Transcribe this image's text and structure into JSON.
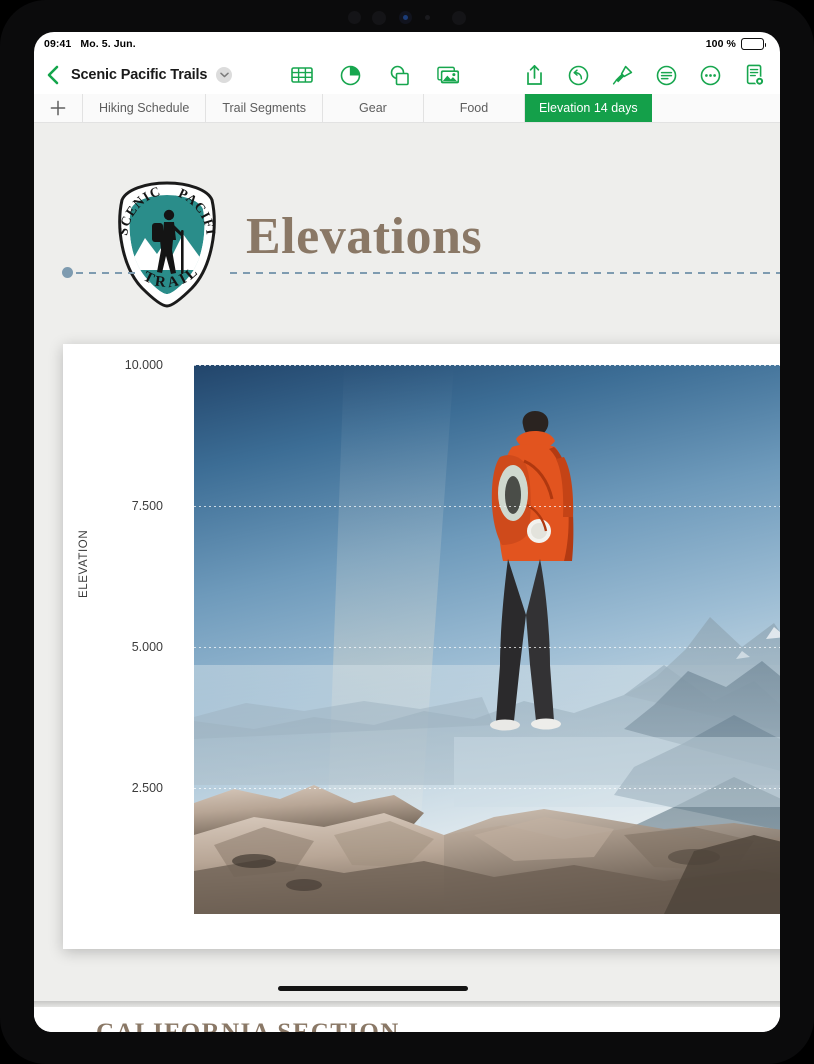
{
  "statusbar": {
    "time": "09:41",
    "date": "Mo. 5. Jun.",
    "battery_percent": "100 %",
    "battery_icon": "battery-full-icon"
  },
  "toolbar": {
    "back_icon": "back-chevron-icon",
    "doc_title": "Scenic Pacific Trails",
    "title_chevron_icon": "chevron-down-icon",
    "center_tools": [
      {
        "name": "insert-table-icon",
        "label": "Table"
      },
      {
        "name": "insert-chart-icon",
        "label": "Chart"
      },
      {
        "name": "insert-shape-icon",
        "label": "Shape"
      },
      {
        "name": "insert-media-icon",
        "label": "Media"
      }
    ],
    "right_tools": [
      {
        "name": "share-icon",
        "label": "Share"
      },
      {
        "name": "undo-icon",
        "label": "Undo"
      },
      {
        "name": "format-brush-icon",
        "label": "Format"
      },
      {
        "name": "format-panel-icon",
        "label": "Format Panel"
      },
      {
        "name": "more-options-icon",
        "label": "More"
      },
      {
        "name": "document-options-icon",
        "label": "Document"
      }
    ]
  },
  "tabs": {
    "add_icon": "plus-icon",
    "items": [
      {
        "label": "Hiking Schedule",
        "active": false
      },
      {
        "label": "Trail Segments",
        "active": false
      },
      {
        "label": "Gear",
        "active": false
      },
      {
        "label": "Food",
        "active": false
      },
      {
        "label": "Elevation 14 days",
        "active": true
      }
    ],
    "active_color": "#14a04a"
  },
  "slide": {
    "title": "Elevations",
    "title_color": "#8a7866",
    "background": "#eeeeec",
    "logo": {
      "name": "scenic-pacific-trails-badge-logo",
      "text_top_left": "SCENIC",
      "text_top_right": "PACIFIC",
      "text_bottom": "TRAILS",
      "badge_color": "#2a8d8a"
    },
    "selection_handle_color": "#7e9bb0"
  },
  "next_slide": {
    "title": "CALIFORNIA SECTION"
  },
  "chart_data": {
    "type": "area",
    "title": "",
    "xlabel": "",
    "ylabel": "ELEVATION",
    "ylim": [
      0,
      10000
    ],
    "yticks": [
      10000,
      7500,
      5000,
      2500
    ],
    "ytick_labels": [
      "10.000",
      "7.500",
      "5.000",
      "2.500"
    ],
    "grid": true,
    "legend": "none",
    "image_fill": {
      "name": "hiker-summit-photo-fill",
      "description": "Photo of a hiker in an orange jacket with backpack standing on a rocky summit overlooking hazy layered mountain ridges, used as the chart series fill"
    },
    "series": [
      {
        "name": "Elevation",
        "values": []
      }
    ]
  },
  "home_indicator": "home-indicator"
}
